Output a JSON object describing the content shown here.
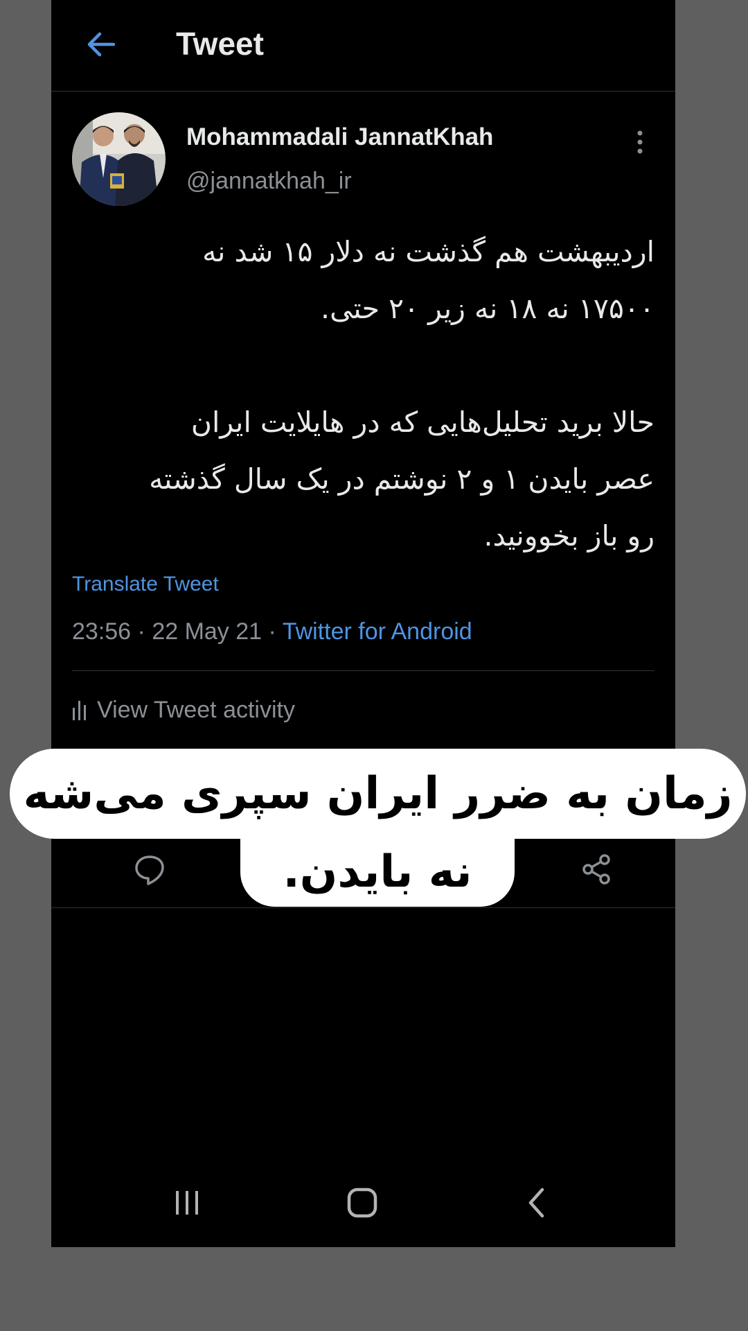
{
  "header": {
    "title": "Tweet",
    "back_icon": "arrow-left-icon"
  },
  "tweet": {
    "author_name": "Mohammadali JannatKhah",
    "author_handle": "@jannatkhah_ir",
    "text": "اردیبهشت هم گذشت نه دلار ۱۵ شد نه\n۱۷۵۰۰ نه ۱۸ نه زیر ۲۰ حتی.\n\nحالا برید تحلیل‌هایی که در هایلایت ایران\nعصر بایدن ۱ و ۲ نوشتم در یک سال گذشته\nرو باز بخوونید.",
    "translate_label": "Translate Tweet",
    "time": "23:56",
    "date": "22 May 21",
    "separator": " · ",
    "source": "Twitter for Android",
    "activity_label": "View Tweet activity"
  },
  "actions": [
    "reply-icon",
    "share-icon"
  ],
  "caption": {
    "line1": "زمان به ضرر ایران سپری می‌شه",
    "line2": "نه بایدن."
  },
  "colors": {
    "background": "#000000",
    "accent": "#4f94e3",
    "text_primary": "#e7e9ea",
    "text_secondary": "#8b9196",
    "frame": "#5f5f5f"
  }
}
